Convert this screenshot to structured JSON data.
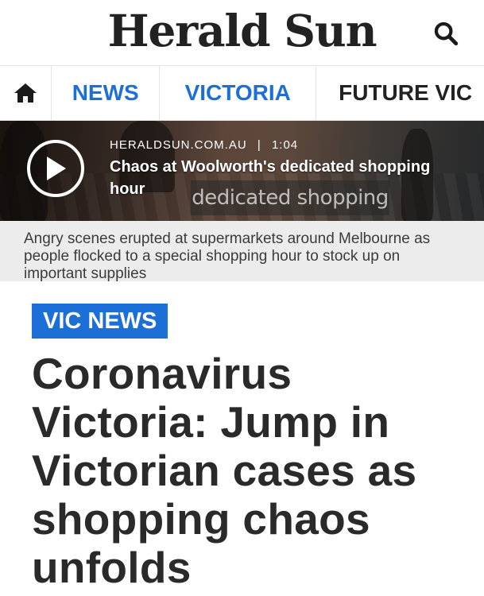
{
  "header": {
    "logo": "Herald Sun",
    "search_icon": "search-icon"
  },
  "nav": {
    "home_icon": "home-icon",
    "tabs": [
      {
        "label": "NEWS"
      },
      {
        "label": "VICTORIA"
      },
      {
        "label": "FUTURE VIC"
      }
    ]
  },
  "video": {
    "source": "HERALDSUN.COM.AU",
    "separator": "|",
    "duration": "1:04",
    "title": "Chaos at Woolworth's dedicated shopping hour",
    "burned_caption": "dedicated shopping hour",
    "summary": "Angry scenes erupted at supermarkets around Melbourne as people flocked to a special shopping hour to stock up on important supplies"
  },
  "article": {
    "kicker": "VIC NEWS",
    "headline": "Coronavirus Victoria: Jump in Victorian cases as shopping chaos unfolds"
  },
  "colors": {
    "accent": "#1b6fd6",
    "text": "#2a2a2a",
    "summary_bg": "#ececec"
  }
}
